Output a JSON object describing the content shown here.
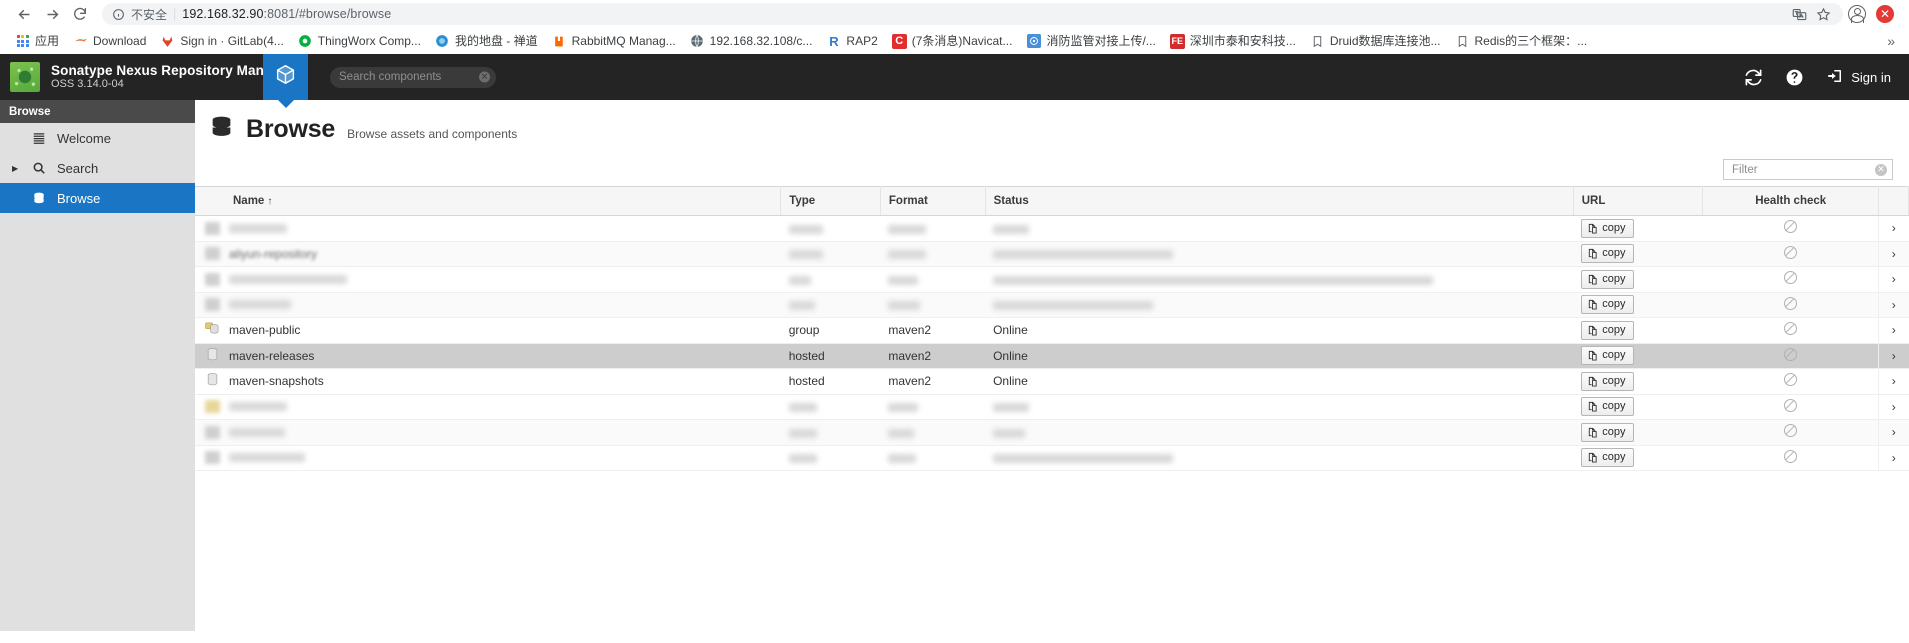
{
  "browser": {
    "back_icon": "back-arrow-icon",
    "forward_icon": "forward-arrow-icon",
    "reload_icon": "reload-icon",
    "security_label": "不安全",
    "url": "192.168.32.90:8081/#browse/browse",
    "url_host": "192.168.32.90",
    "url_rest": ":8081/#browse/browse",
    "translate_icon": "translate-icon",
    "bookmark_star_icon": "star-icon",
    "profile_icon": "profile-icon",
    "extension_icon": "extension-icon",
    "bookmarks": [
      {
        "label": "应用",
        "icon": "apps-grid-icon"
      },
      {
        "label": "Download",
        "icon": "download-icon"
      },
      {
        "label": "Sign in · GitLab(4...",
        "icon": "gitlab-icon"
      },
      {
        "label": "ThingWorx Comp...",
        "icon": "thingworx-icon"
      },
      {
        "label": "我的地盘 - 禅道",
        "icon": "zentao-icon"
      },
      {
        "label": "RabbitMQ Manag...",
        "icon": "rabbitmq-icon"
      },
      {
        "label": "192.168.32.108/c...",
        "icon": "globe-icon"
      },
      {
        "label": "RAP2",
        "icon": "rap2-icon"
      },
      {
        "label": "(7条消息)Navicat...",
        "icon": "csdn-icon"
      },
      {
        "label": "消防监管对接上传/...",
        "icon": "target-icon"
      },
      {
        "label": "深圳市泰和安科技...",
        "icon": "taihean-icon"
      },
      {
        "label": "Druid数据库连接池...",
        "icon": "bookmark-icon"
      },
      {
        "label": "Redis的三个框架：...",
        "icon": "bookmark-icon"
      }
    ],
    "overflow_label": "»"
  },
  "app_header": {
    "title": "Sonatype Nexus Repository Manager",
    "version": "OSS 3.14.0-04",
    "logo_icon": "nexus-logo-icon",
    "cube_icon": "cube-icon",
    "search_placeholder": "Search components",
    "search_value": "",
    "refresh_icon": "refresh-icon",
    "help_icon": "help-icon",
    "signin_icon": "sign-in-icon",
    "signin_label": "Sign in",
    "accent_blue": "#1a76c4",
    "bg_dark": "#242424"
  },
  "sidebar": {
    "header": "Browse",
    "items": [
      {
        "label": "Welcome",
        "icon": "welcome-lines-icon",
        "caret": "",
        "selected": false
      },
      {
        "label": "Search",
        "icon": "search-icon",
        "caret": "▶",
        "selected": false
      },
      {
        "label": "Browse",
        "icon": "database-icon",
        "caret": "",
        "selected": true
      }
    ]
  },
  "main": {
    "title": "Browse",
    "title_icon": "database-icon",
    "subtitle": "Browse assets and components",
    "filter": {
      "placeholder": "Filter",
      "value": "",
      "clear_icon": "clear-icon"
    }
  },
  "table": {
    "columns": [
      {
        "key": "name",
        "label": "Name",
        "sort": "↑"
      },
      {
        "key": "type",
        "label": "Type",
        "sort": ""
      },
      {
        "key": "format",
        "label": "Format",
        "sort": ""
      },
      {
        "key": "status",
        "label": "Status",
        "sort": ""
      },
      {
        "key": "url",
        "label": "URL",
        "sort": ""
      },
      {
        "key": "health",
        "label": "Health check",
        "sort": ""
      }
    ],
    "copy_label": "copy",
    "copy_icon": "clipboard-icon",
    "health_icon": "no-entry-icon",
    "row_chevron": "›",
    "rows": [
      {
        "name": "",
        "type": "",
        "format": "",
        "status": "",
        "redacted": true,
        "icon": "blur-icon",
        "highlight": false
      },
      {
        "name": "aliyun-repository",
        "type": "",
        "format": "",
        "status": "",
        "redacted": true,
        "partial": true,
        "icon": "proxy-icon",
        "highlight": false
      },
      {
        "name": "",
        "type": "",
        "format": "",
        "status": "",
        "redacted": true,
        "icon": "blur-icon",
        "highlight": false
      },
      {
        "name": "",
        "type": "",
        "format": "",
        "status": "",
        "redacted": true,
        "icon": "blur-icon",
        "highlight": false
      },
      {
        "name": "maven-public",
        "type": "group",
        "format": "maven2",
        "status": "Online",
        "redacted": false,
        "icon": "group-icon",
        "highlight": false
      },
      {
        "name": "maven-releases",
        "type": "hosted",
        "format": "maven2",
        "status": "Online",
        "redacted": false,
        "icon": "hosted-icon",
        "highlight": true
      },
      {
        "name": "maven-snapshots",
        "type": "hosted",
        "format": "maven2",
        "status": "Online",
        "redacted": false,
        "icon": "hosted-icon",
        "highlight": false
      },
      {
        "name": "",
        "type": "",
        "format": "",
        "status": "",
        "redacted": true,
        "icon": "blur-icon-yellow",
        "highlight": false
      },
      {
        "name": "",
        "type": "",
        "format": "",
        "status": "",
        "redacted": true,
        "icon": "blur-icon",
        "highlight": false
      },
      {
        "name": "",
        "type": "",
        "format": "",
        "status": "",
        "redacted": true,
        "icon": "blur-icon",
        "highlight": false
      }
    ]
  }
}
